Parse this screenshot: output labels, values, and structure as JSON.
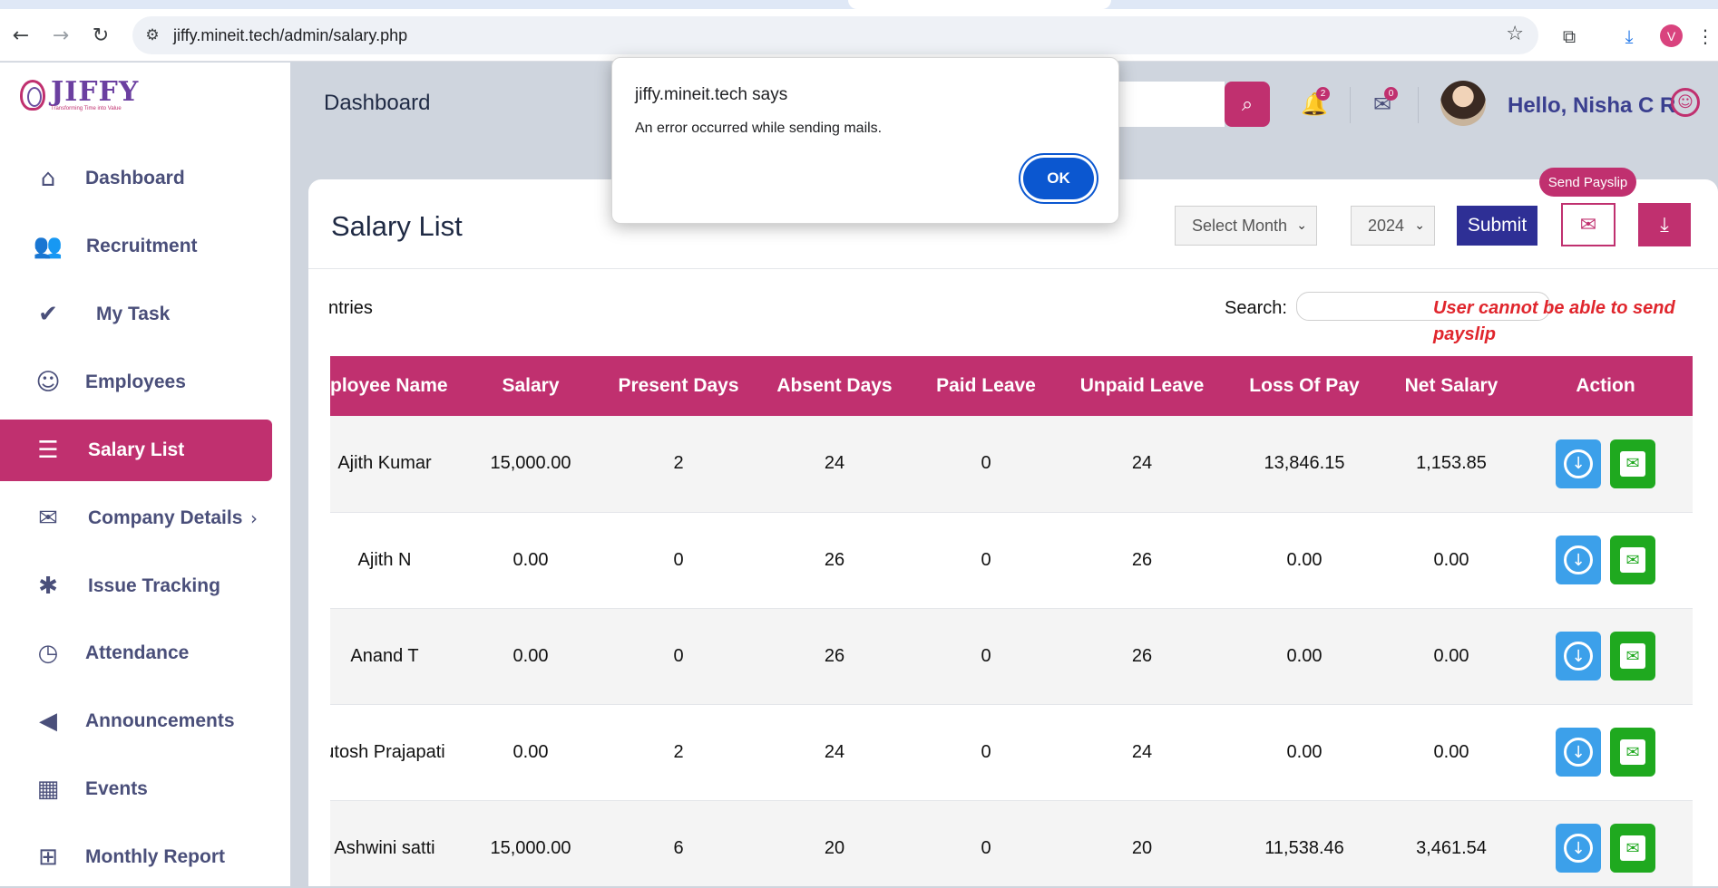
{
  "browser": {
    "url": "jiffy.mineit.tech/admin/salary.php",
    "profile_initial": "V"
  },
  "brand": {
    "name": "JIFFY",
    "tagline": "Transforming Time into Value"
  },
  "sidebar": {
    "items": [
      {
        "label": "Dashboard",
        "icon": "home-icon"
      },
      {
        "label": "Recruitment",
        "icon": "users-icon"
      },
      {
        "label": "My Task",
        "icon": "check-circle-icon"
      },
      {
        "label": "Employees",
        "icon": "user-icon"
      },
      {
        "label": "Salary List",
        "icon": "list-icon",
        "active": true
      },
      {
        "label": "Company Details",
        "icon": "briefcase-icon"
      },
      {
        "label": "Issue Tracking",
        "icon": "bug-icon"
      },
      {
        "label": "Attendance",
        "icon": "clock-icon"
      },
      {
        "label": "Announcements",
        "icon": "megaphone-icon"
      },
      {
        "label": "Events",
        "icon": "calendar-icon"
      },
      {
        "label": "Monthly Report",
        "icon": "grid-icon"
      }
    ]
  },
  "header": {
    "title": "Dashboard",
    "notifications_count": "2",
    "mail_count": "0",
    "greeting": "Hello, Nisha C R"
  },
  "card": {
    "title": "Salary List",
    "month_select": "Select Month",
    "year_select": "2024",
    "submit_label": "Submit",
    "send_payslip_tooltip": "Send Payslip",
    "entries_label": "ntries",
    "search_label": "Search:",
    "annotation": "User cannot be able to send payslip"
  },
  "table": {
    "headers": [
      "ployee Name",
      "Salary",
      "Present Days",
      "Absent Days",
      "Paid Leave",
      "Unpaid Leave",
      "Loss Of Pay",
      "Net Salary",
      "Action"
    ],
    "rows": [
      [
        "Ajith Kumar",
        "15,000.00",
        "2",
        "24",
        "0",
        "24",
        "13,846.15",
        "1,153.85"
      ],
      [
        "Ajith N",
        "0.00",
        "0",
        "26",
        "0",
        "26",
        "0.00",
        "0.00"
      ],
      [
        "Anand T",
        "0.00",
        "0",
        "26",
        "0",
        "26",
        "0.00",
        "0.00"
      ],
      [
        "utosh Prajapati",
        "0.00",
        "2",
        "24",
        "0",
        "24",
        "0.00",
        "0.00"
      ],
      [
        "Ashwini satti",
        "15,000.00",
        "6",
        "20",
        "0",
        "20",
        "11,538.46",
        "3,461.54"
      ]
    ]
  },
  "dialog": {
    "title": "jiffy.mineit.tech says",
    "message": "An error occurred while sending mails.",
    "ok_label": "OK"
  },
  "colors": {
    "accent": "#c0306f",
    "primary_button": "#2e2f95",
    "download_action": "#3ca0ea",
    "mail_action": "#1fa91f",
    "annotation": "#e0262d"
  }
}
